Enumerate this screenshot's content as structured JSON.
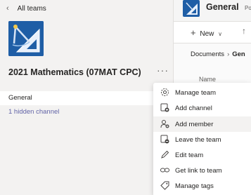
{
  "left_panel": {
    "back_label": "All teams",
    "team_name": "2021 Mathematics (07MAT CPC)",
    "more_label": "···",
    "channels": {
      "general": "General",
      "hidden": "1 hidden channel"
    }
  },
  "right_panel": {
    "title": "General",
    "title_tab_partial": "Po",
    "new_label": "New",
    "breadcrumb": {
      "root": "Documents",
      "current": "Gen"
    },
    "column_header": "Name"
  },
  "context_menu": {
    "items": [
      {
        "label": "Manage team",
        "icon": "gear-icon"
      },
      {
        "label": "Add channel",
        "icon": "add-channel-icon"
      },
      {
        "label": "Add member",
        "icon": "add-member-icon",
        "highlighted": true
      },
      {
        "label": "Leave the team",
        "icon": "leave-team-icon"
      },
      {
        "label": "Edit team",
        "icon": "pencil-icon"
      },
      {
        "label": "Get link to team",
        "icon": "link-icon"
      },
      {
        "label": "Manage tags",
        "icon": "tag-icon"
      }
    ]
  },
  "colors": {
    "accent": "#6264a7",
    "logo_bg": "#1f5ea6",
    "menu_highlight": "#f3f2f1"
  }
}
